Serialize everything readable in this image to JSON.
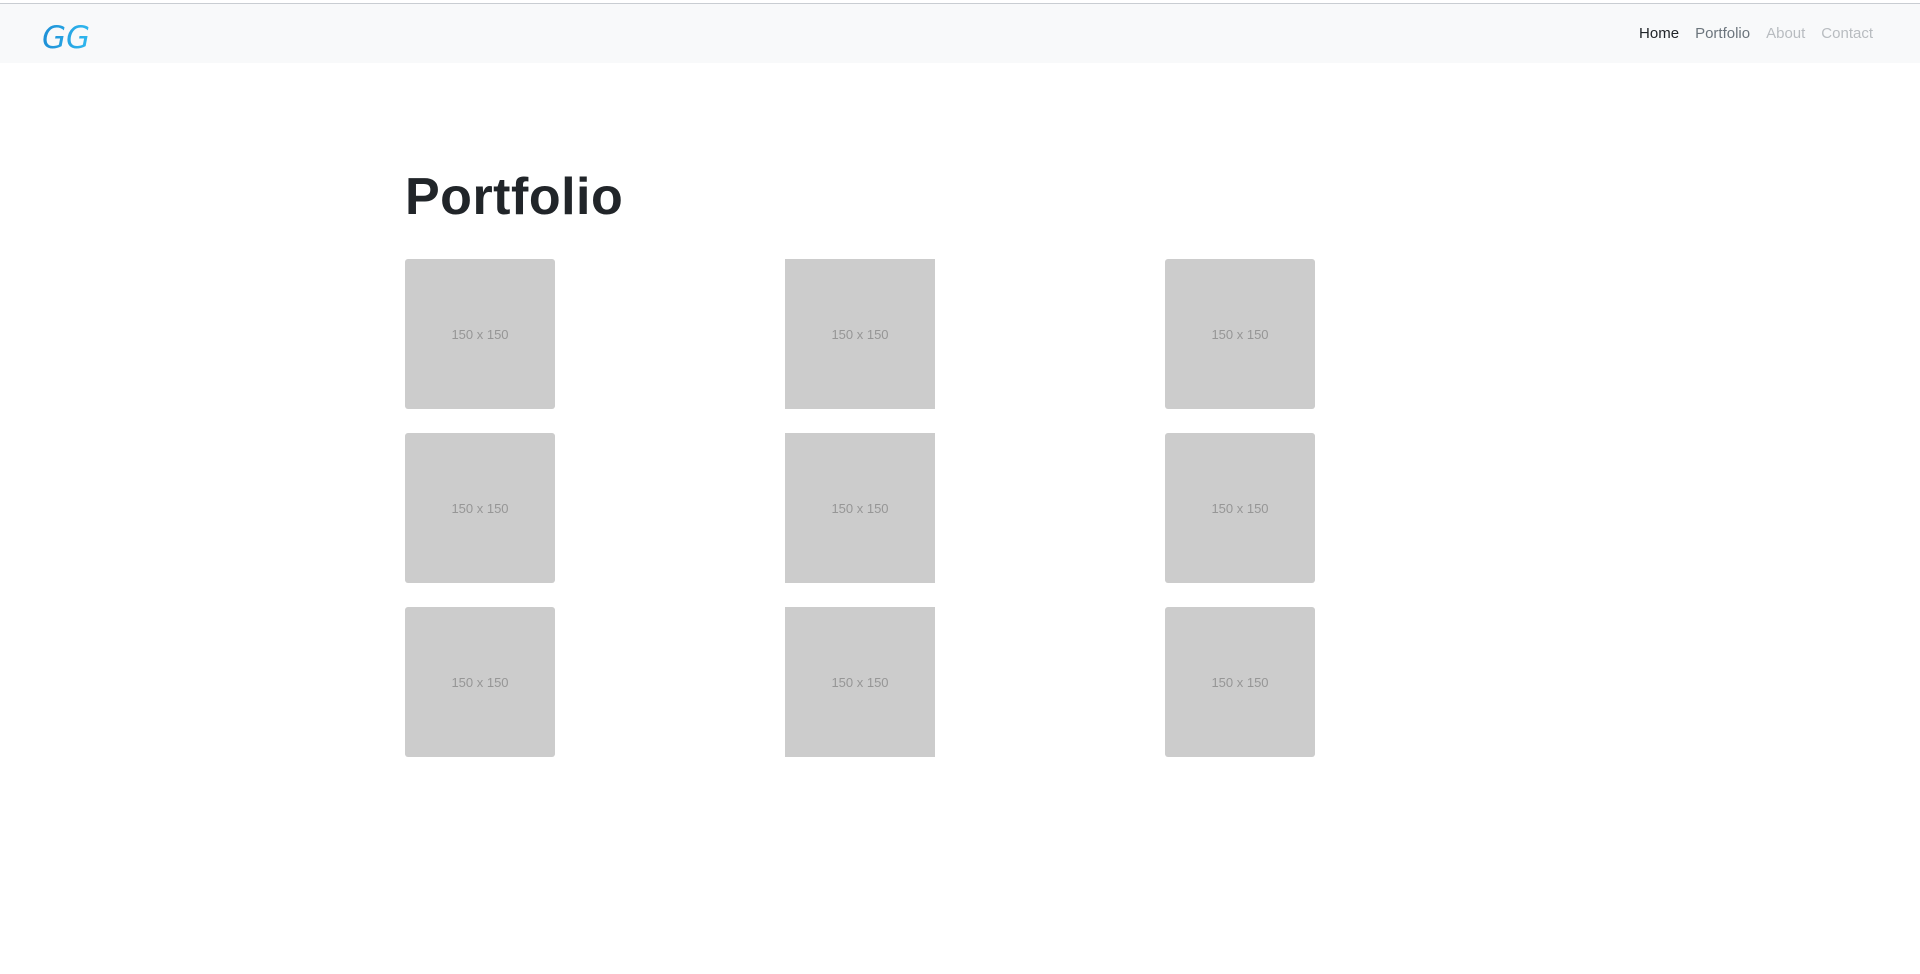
{
  "header": {
    "logo": {
      "text": "GG",
      "colors": [
        "#1e8fd6",
        "#2fb8ef"
      ]
    },
    "nav": {
      "items": [
        {
          "label": "Home",
          "state": "active"
        },
        {
          "label": "Portfolio",
          "state": "normal"
        },
        {
          "label": "About",
          "state": "muted"
        },
        {
          "label": "Contact",
          "state": "muted"
        }
      ]
    }
  },
  "main": {
    "title": "Portfolio",
    "gallery": {
      "tiles": [
        {
          "label": "150 x 150"
        },
        {
          "label": "150 x 150"
        },
        {
          "label": "150 x 150"
        },
        {
          "label": "150 x 150"
        },
        {
          "label": "150 x 150"
        },
        {
          "label": "150 x 150"
        },
        {
          "label": "150 x 150"
        },
        {
          "label": "150 x 150"
        },
        {
          "label": "150 x 150"
        }
      ]
    }
  },
  "colors": {
    "navbar_bg": "#f8f9fa",
    "placeholder_bg": "#cccccc",
    "placeholder_text": "#969696",
    "title_text": "#212529"
  }
}
